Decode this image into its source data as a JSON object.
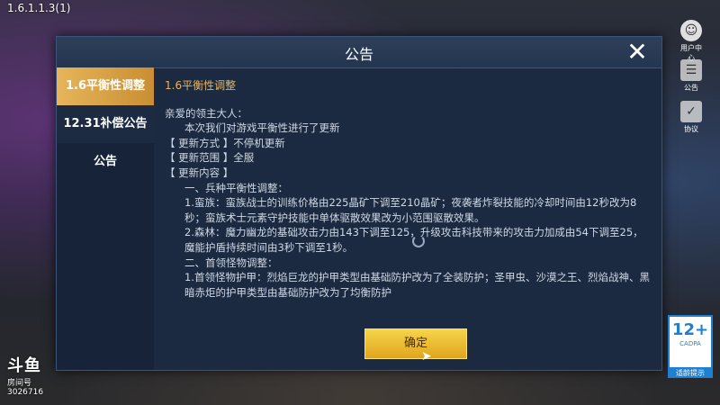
{
  "version": "1.6.1.1.3(1)",
  "side": {
    "user_center": "用户中心",
    "notice": "公告",
    "agreement": "协议"
  },
  "dialog": {
    "title": "公告",
    "close": "✕",
    "tabs": [
      "1.6平衡性调整",
      "12.31补偿公告",
      "公告"
    ],
    "content_heading": "1.6平衡性调整",
    "lines": [
      "亲爱的领主大人：",
      "本次我们对游戏平衡性进行了更新",
      "【 更新方式 】不停机更新",
      "【 更新范围 】全服",
      "【 更新内容 】",
      "一、兵种平衡性调整：",
      "1.蛮族：蛮族战士的训练价格由225晶矿下调至210晶矿；夜袭者炸裂技能的冷却时间由12秒改为8秒；蛮族术士元素守护技能中单体驱散效果改为小范围驱散效果。",
      "2.森林：魔力幽龙的基础攻击力由143下调至125，升级攻击科技带来的攻击力加成由54下调至25，魔能护盾持续时间由3秒下调至1秒。",
      "二、首领怪物调整：",
      "1.首领怪物护甲：烈焰巨龙的护甲类型由基础防护改为了全装防护；圣甲虫、沙漠之王、烈焰战神、黑暗赤炬的护甲类型由基础防护改为了均衡防护"
    ],
    "confirm": "确定"
  },
  "badge": {
    "age": "12+",
    "org": "CADPA",
    "tip": "适龄提示"
  },
  "logo": {
    "brand": "斗鱼",
    "room_label": "房间号",
    "room_id": "3026716"
  },
  "colors": {
    "accent": "#e8b45e",
    "dialog_bg": "#1b2a40",
    "confirm": "#f2c436"
  }
}
